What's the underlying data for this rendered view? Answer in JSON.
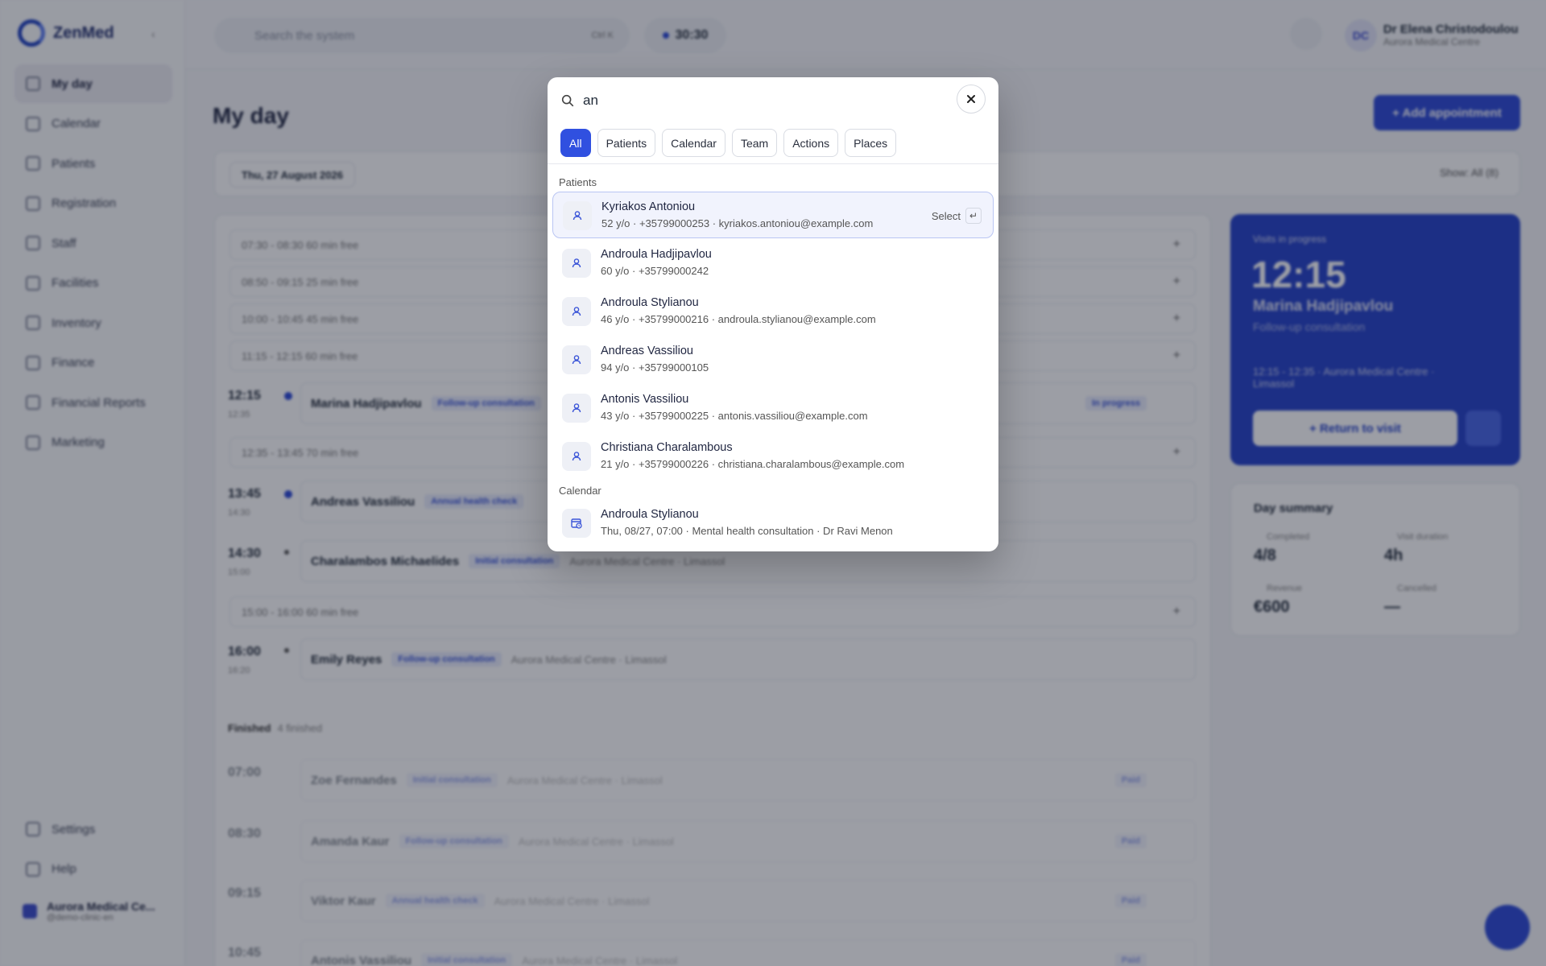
{
  "app": {
    "logo": "ZenMed",
    "nav": [
      {
        "label": "My day",
        "active": true
      },
      {
        "label": "Calendar"
      },
      {
        "label": "Patients"
      },
      {
        "label": "Registration"
      },
      {
        "label": "Staff"
      },
      {
        "label": "Facilities"
      },
      {
        "label": "Inventory"
      },
      {
        "label": "Finance"
      },
      {
        "label": "Financial Reports"
      },
      {
        "label": "Marketing"
      }
    ],
    "bottom_nav": [
      {
        "label": "Settings"
      },
      {
        "label": "Help"
      }
    ],
    "org": {
      "name": "Aurora Medical Ce...",
      "sub": "@demo-clinic-en"
    }
  },
  "topbar": {
    "search_placeholder": "Search the system",
    "search_shortcut": "Ctrl K",
    "timer": "30:30",
    "avatar_initials": "DC",
    "user_name": "Dr Elena Christodoulou",
    "user_org": "Aurora Medical Centre"
  },
  "main": {
    "title": "My day",
    "add_button": "+ Add appointment",
    "date": "Thu, 27 August 2026",
    "show_filter": "Show: All (8)",
    "free_slots": [
      {
        "text": "07:30 - 08:30   60 min free"
      },
      {
        "text": "08:50 - 09:15   25 min free"
      },
      {
        "text": "10:00 - 10:45   45 min free"
      },
      {
        "text": "11:15 - 12:15   60 min free"
      },
      {
        "text": "12:35 - 13:45   70 min free"
      },
      {
        "text": "15:00 - 16:00   60 min free"
      }
    ],
    "appointments": [
      {
        "time": "12:15",
        "end": "12:35",
        "name": "Marina Hadjipavlou",
        "type": "Follow-up consultation",
        "loc": "",
        "status": "In progress"
      },
      {
        "time": "13:45",
        "end": "14:30",
        "name": "Andreas Vassiliou",
        "type": "Annual health check",
        "loc": "",
        "status": ""
      },
      {
        "time": "14:30",
        "end": "15:00",
        "name": "Charalambos Michaelides",
        "type": "Initial consultation",
        "loc": "Aurora Medical Centre · Limassol",
        "status": ""
      },
      {
        "time": "16:00",
        "end": "16:20",
        "name": "Emily Reyes",
        "type": "Follow-up consultation",
        "loc": "Aurora Medical Centre · Limassol",
        "status": ""
      }
    ],
    "finished_label": "Finished",
    "finished_count": "4 finished",
    "finished": [
      {
        "time": "07:00",
        "name": "Zoe Fernandes",
        "type": "Initial consultation",
        "loc": "Aurora Medical Centre · Limassol",
        "badge": "Paid"
      },
      {
        "time": "08:30",
        "name": "Amanda Kaur",
        "type": "Follow-up consultation",
        "loc": "Aurora Medical Centre · Limassol",
        "badge": "Paid"
      },
      {
        "time": "09:15",
        "name": "Viktor Kaur",
        "type": "Annual health check",
        "loc": "Aurora Medical Centre · Limassol",
        "badge": "Paid"
      },
      {
        "time": "10:45",
        "name": "Antonis Vassiliou",
        "type": "Initial consultation",
        "loc": "Aurora Medical Centre · Limassol",
        "badge": "Paid"
      }
    ]
  },
  "visit_panel": {
    "label": "Visits in progress",
    "time": "12:15",
    "patient": "Marina Hadjipavlou",
    "type": "Follow-up consultation",
    "line": "12:15 - 12:35 · Aurora Medical Centre · Limassol",
    "button": "+ Return to visit"
  },
  "summary": {
    "title": "Day summary",
    "completed_label": "Completed",
    "completed": "4/8",
    "duration_label": "Visit duration",
    "duration": "4h",
    "revenue_label": "Revenue",
    "revenue": "€600",
    "cancelled_label": "Cancelled",
    "cancelled": "—"
  },
  "modal": {
    "query": "an",
    "tabs": [
      {
        "label": "All",
        "active": true
      },
      {
        "label": "Patients"
      },
      {
        "label": "Calendar"
      },
      {
        "label": "Team"
      },
      {
        "label": "Actions"
      },
      {
        "label": "Places"
      }
    ],
    "patients_header": "Patients",
    "patients": [
      {
        "name": "Kyriakos Antoniou",
        "sub": "52 y/o · +35799000253 · kyriakos.antoniou@example.com",
        "selected": true
      },
      {
        "name": "Androula Hadjipavlou",
        "sub": "60 y/o · +35799000242"
      },
      {
        "name": "Androula Stylianou",
        "sub": "46 y/o · +35799000216 · androula.stylianou@example.com"
      },
      {
        "name": "Andreas Vassiliou",
        "sub": "94 y/o · +35799000105"
      },
      {
        "name": "Antonis Vassiliou",
        "sub": "43 y/o · +35799000225 · antonis.vassiliou@example.com"
      },
      {
        "name": "Christiana Charalambous",
        "sub": "21 y/o · +35799000226 · christiana.charalambous@example.com"
      }
    ],
    "select_label": "Select",
    "enter_glyph": "↵",
    "calendar_header": "Calendar",
    "calendar": [
      {
        "name": "Androula Stylianou",
        "sub": "Thu, 08/27, 07:00 · Mental health consultation · Dr Ravi Menon"
      }
    ]
  },
  "colors": {
    "accent": "#2b48d6",
    "overlay": "rgba(20,24,40,0.42)"
  }
}
